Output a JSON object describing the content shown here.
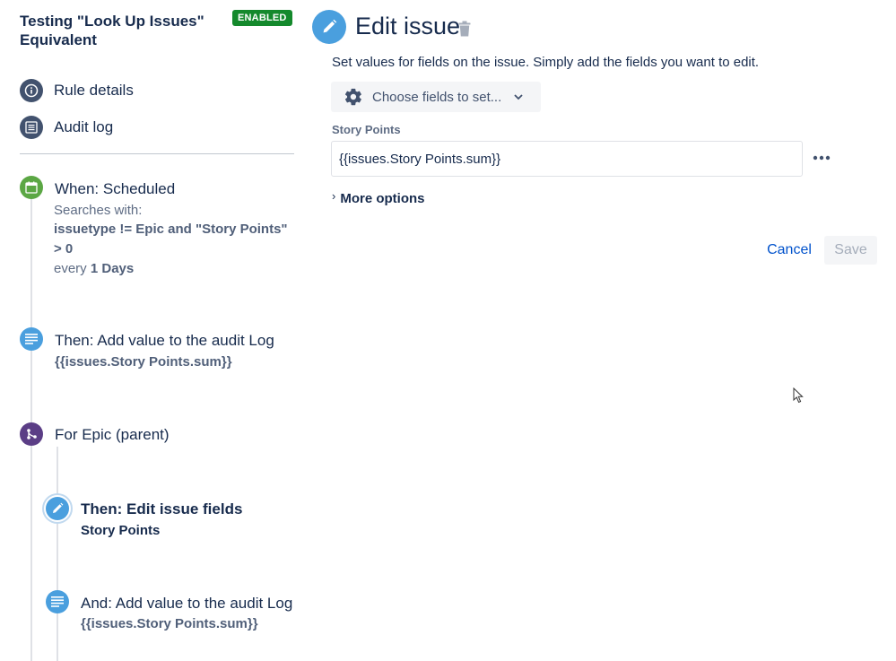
{
  "rule": {
    "title": "Testing \"Look Up Issues\" Equivalent",
    "status": "ENABLED"
  },
  "nav": {
    "rule_details": "Rule details",
    "audit_log": "Audit log"
  },
  "components": {
    "trigger": {
      "title": "When: Scheduled",
      "searches_label": "Searches with:",
      "jql_line1": "issuetype != Epic and \"Story Points\"",
      "jql_line2": "> 0",
      "every_label": "every",
      "every_value": "1 Days"
    },
    "action1": {
      "title": "Then: Add value to the audit Log",
      "detail": "{{issues.Story Points.sum}}"
    },
    "branch": {
      "title": "For Epic (parent)"
    },
    "action2": {
      "title": "Then: Edit issue fields",
      "detail": "Story Points"
    },
    "action3": {
      "title": "And: Add value to the audit Log",
      "detail": "{{issues.Story Points.sum}}"
    }
  },
  "editor": {
    "title": "Edit issue",
    "description": "Set values for fields on the issue. Simply add the fields you want to edit.",
    "choose_fields": "Choose fields to set...",
    "field_label": "Story Points",
    "field_value": "{{issues.Story Points.sum}}",
    "more_options": "More options",
    "cancel": "Cancel",
    "save": "Save"
  },
  "colors": {
    "enabled_badge": "#14892c",
    "trigger_icon": "#5ba744",
    "action_icon": "#4a9fde",
    "branch_icon": "#5b3e86",
    "nav_icon": "#42526e",
    "link": "#0052cc"
  },
  "icons": {
    "rule_details": "info-icon",
    "audit_log": "list-icon",
    "trigger": "calendar-icon",
    "action_log": "log-lines-icon",
    "branch": "branch-icon",
    "edit": "pencil-icon",
    "delete": "trash-icon",
    "settings": "gear-icon",
    "dropdown": "chevron-down-icon",
    "more": "more-horizontal-icon",
    "expand": "chevron-right-icon",
    "cursor": "mouse-pointer-icon"
  }
}
